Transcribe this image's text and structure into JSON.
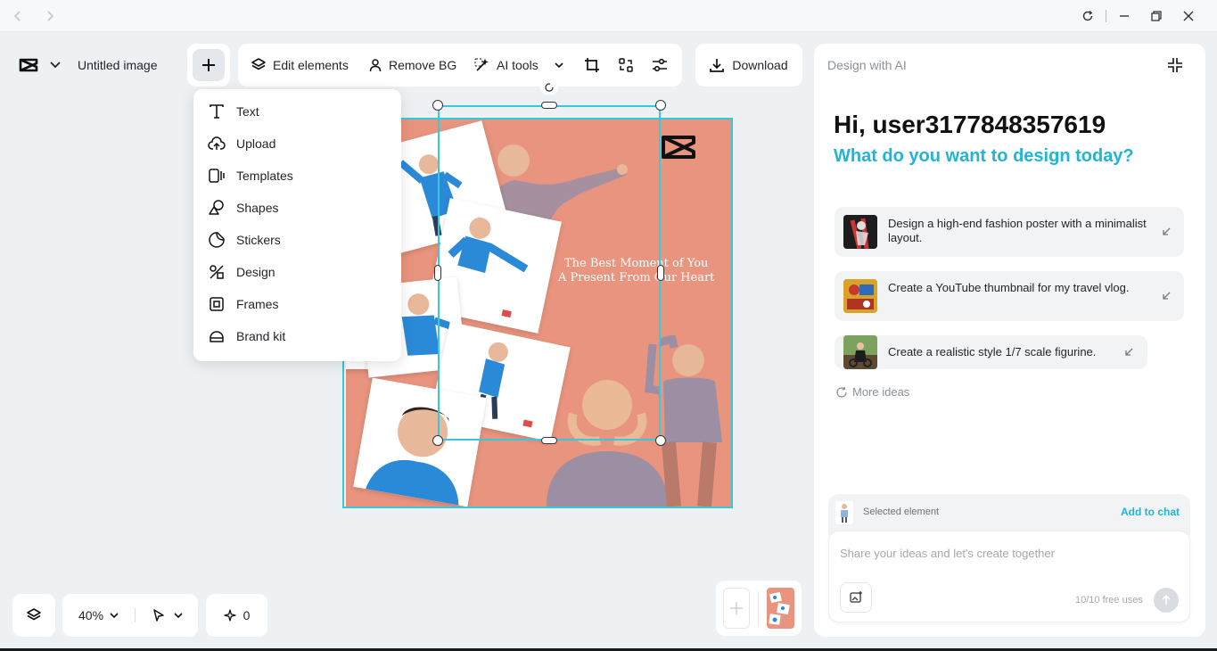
{
  "titlebar": {
    "back_icon": "chevron-left-icon",
    "forward_icon": "chevron-right-icon"
  },
  "header": {
    "doc_title": "Untitled image"
  },
  "toolbar": {
    "edit_elements": "Edit elements",
    "remove_bg": "Remove BG",
    "ai_tools": "AI tools",
    "download": "Download"
  },
  "add_menu": {
    "items": [
      {
        "label": "Text",
        "icon": "text-icon"
      },
      {
        "label": "Upload",
        "icon": "upload-cloud-icon"
      },
      {
        "label": "Templates",
        "icon": "templates-icon"
      },
      {
        "label": "Shapes",
        "icon": "shapes-icon"
      },
      {
        "label": "Stickers",
        "icon": "sticker-icon"
      },
      {
        "label": "Design",
        "icon": "design-icon"
      },
      {
        "label": "Frames",
        "icon": "frame-icon"
      },
      {
        "label": "Brand kit",
        "icon": "brand-kit-icon"
      }
    ]
  },
  "canvas": {
    "line1": "The Best Moment of You",
    "line2": "A Present From Our Heart",
    "background_color": "#e9947e",
    "selection_color": "#38c8dc"
  },
  "bottom": {
    "zoom": "40%",
    "ai_count": "0"
  },
  "panel": {
    "title": "Design with AI",
    "greeting": "Hi, user3177848357619",
    "subtitle": "What do you want to design today?",
    "ideas": [
      "Design a high-end fashion poster with a minimalist layout.",
      "Create a YouTube thumbnail for my travel vlog.",
      "Create a realistic style 1/7 scale figurine."
    ],
    "more_ideas": "More ideas",
    "selected_element": "Selected element",
    "add_to_chat": "Add to chat",
    "input_placeholder": "Share your ideas and let's create together",
    "free_uses": "10/10 free uses",
    "accent": "#1fb5d6"
  }
}
